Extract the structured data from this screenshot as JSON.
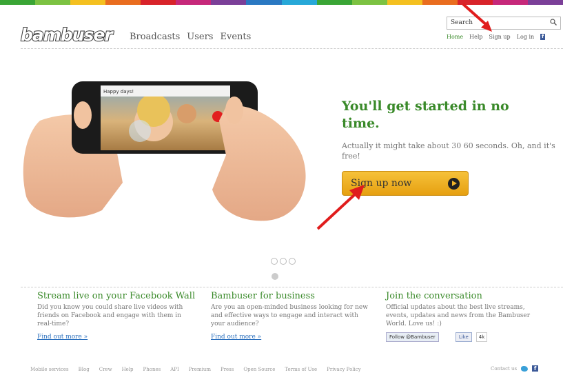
{
  "color_bar": [
    "#3aa535",
    "#7cc242",
    "#f4c020",
    "#e96d1f",
    "#d8232a",
    "#c6287a",
    "#7b3f98",
    "#2a78c2",
    "#27a8d8",
    "#3aa535",
    "#7cc242",
    "#f4c020",
    "#e96d1f",
    "#d8232a",
    "#c6287a",
    "#7b3f98"
  ],
  "logo": "bambuser",
  "nav": {
    "broadcasts": "Broadcasts",
    "users": "Users",
    "events": "Events"
  },
  "search": {
    "placeholder": "Search",
    "icon": "search-icon"
  },
  "topnav": {
    "home": "Home",
    "help": "Help",
    "signup": "Sign up",
    "login": "Log in",
    "fb": "f"
  },
  "hero": {
    "phone_caption": "Happy days!",
    "title": "You'll get started in no time.",
    "subtitle": "Actually it might take about 30 60 seconds. Oh, and it's free!",
    "cta": "Sign up now"
  },
  "columns": {
    "facebook": {
      "title": "Stream live on your Facebook Wall",
      "text": "Did you know you could share live videos with friends on Facebook and engage with them in real-time?",
      "link": "Find out more »"
    },
    "business": {
      "title": "Bambuser for business",
      "text": "Are you an open-minded business looking for new and effective ways to engage and interact with your audience?",
      "link": "Find out more »"
    },
    "conversation": {
      "title": "Join the conversation",
      "text": "Official updates about the best live streams, events, updates and news from the Bambuser World. Love us! :)",
      "follow": "Follow @Bambuser",
      "like": "Like",
      "like_count": "4k"
    }
  },
  "footer": {
    "links": [
      "Mobile services",
      "Blog",
      "Crew",
      "Help",
      "Phones",
      "API",
      "Premium",
      "Press",
      "Open Source",
      "Terms of Use",
      "Privacy Policy"
    ],
    "contact": "Contact us"
  },
  "colors": {
    "accent_green": "#3a8a2a",
    "cta_orange": "#f2b42b",
    "link_blue": "#2a6fbd",
    "arrow_red": "#e01c1c"
  }
}
